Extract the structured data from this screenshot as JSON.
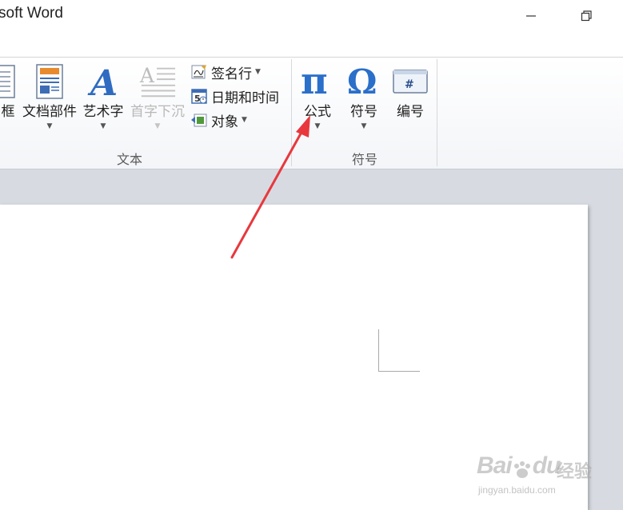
{
  "window": {
    "title": "soft Word"
  },
  "ribbon": {
    "text_group": {
      "label": "文本",
      "textbox_label": "框",
      "quickparts_label": "文档部件",
      "wordart_label": "艺术字",
      "dropcap_label": "首字下沉",
      "signature_label": "签名行",
      "datetime_label": "日期和时间",
      "object_label": "对象"
    },
    "symbols_group": {
      "label": "符号",
      "equation_label": "公式",
      "symbol_label": "符号",
      "number_label": "编号"
    }
  },
  "watermark": {
    "brand": "Bai",
    "brand2": "du",
    "cn": "经验",
    "url": "jingyan.baidu.com"
  },
  "colors": {
    "annotation_arrow": "#e8383d",
    "pi_icon": "#2a6fc9",
    "workspace": "#d7dbe1"
  }
}
